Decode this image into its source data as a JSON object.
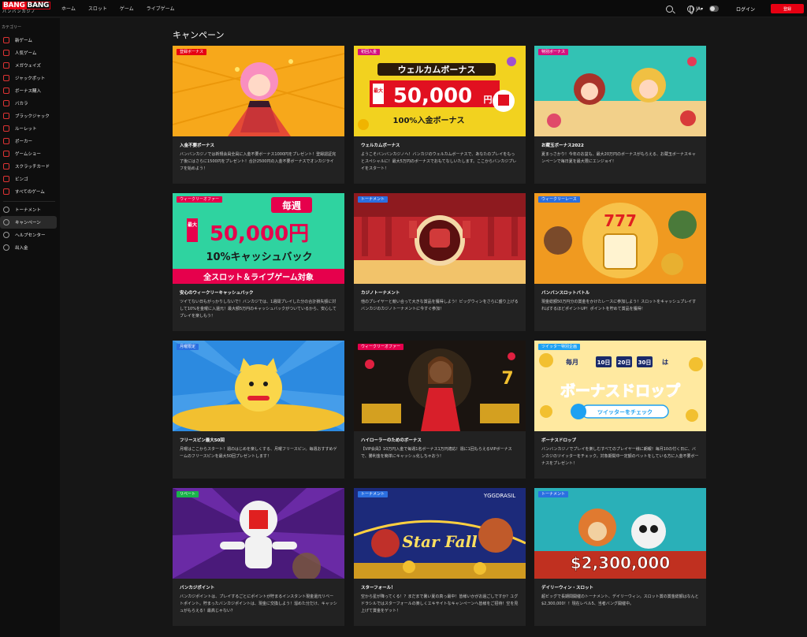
{
  "brand": {
    "logo_a": "BANG",
    "logo_b": "BANG",
    "logo_sub": "バンバンカジノ"
  },
  "nav": [
    "ホーム",
    "スロット",
    "ゲーム",
    "ライブゲーム"
  ],
  "header": {
    "lang": "JA▾",
    "login": "ログイン",
    "register": "登録"
  },
  "sidebar": {
    "category_label": "カテゴリー",
    "items": [
      "新ゲーム",
      "人気ゲーム",
      "メガウェイズ",
      "ジャックポット",
      "ボーナス購入",
      "バカラ",
      "ブラックジャック",
      "ルーレット",
      "ポーカー",
      "ゲームショー",
      "スクラッチカード",
      "ビンゴ",
      "すべてのゲーム"
    ],
    "items2": [
      "トーナメント",
      "キャンペーン",
      "ヘルプセンター",
      "出入金"
    ]
  },
  "page_title": "キャンペーン",
  "colors": {
    "accent": "#e60012",
    "badge_blue": "#2b6fe0"
  },
  "cards": [
    {
      "badge": "登録ボーナス",
      "title": "入金不要ボーナス",
      "desc": "バンバンカジノでは新規会員全員に入金不要ボーナス1000円をプレゼント！登録認証完了後にはさらに1500円をプレゼント！合計2500円の入金不要ボーナスでオンカジライフを始めよう！"
    },
    {
      "badge": "初回入金",
      "title": "ウェルカムボーナス",
      "desc": "ようこそバンバンカジノへ！バンカジのウェルカムボーナスで、あなたのプレイをもっとスペシャルに！最大5万円のボーナスでおもてなしいたします。ここからバンカジプレイをスタート！",
      "img_text1": "ウェルカムボーナス",
      "img_text2": "最大",
      "img_text3": "50,000",
      "img_text4": "円",
      "img_text5": "100%入金ボーナス"
    },
    {
      "badge": "特別ボーナス",
      "title": "お蔵玉ボーナス2022",
      "desc": "夏まっさかり！今年のお盆も、最大20万円のボーナスがもらえる、お蔵玉ボーナスキャンペーンで毎日夏を最大限にエンジョイ！"
    },
    {
      "badge": "ウィークリーオファー",
      "title": "安心のウィークリーキャッシュバック",
      "desc": "ツイてない日もがっかりしないで！バンカジでは、1週間プレイした分の合計損失額に対して10%を金曜に入還元！最大額5万円のキャッシュバックがついているから、安心してプレイを楽しもう！",
      "img_text1": "毎週",
      "img_text2": "最大",
      "img_text3": "50,000円",
      "img_text4": "10%キャッシュバック",
      "img_text5": "全スロット＆ライブゲーム対象"
    },
    {
      "badge": "トーナメント",
      "title": "カジノトーナメント",
      "desc": "他のプレイヤーと競い合って大きな賞品を獲得しよう！ビッグウィンをさらに盛り上げるバンカジのカジノトーナメントに今すぐ参加！"
    },
    {
      "badge": "ウィークリーレース",
      "title": "バンバンスロットバトル",
      "desc": "現金総額50万円分の賞金をかけたレースに参加しよう！スロットをキャッシュプレイすればするほどポイントUP！ポイントを貯めて賞品を獲得！",
      "img_text1": "777"
    },
    {
      "badge": "月曜限定",
      "title": "フリースピン最大50回",
      "desc": "月曜はここからスタート！週のはじめを楽しくする、月曜フリースピン。毎週おすすめゲームのフリースピンを最大50回プレゼントします！"
    },
    {
      "badge": "ウィークリーオファー",
      "title": "ハイローラーのためのボーナス",
      "desc": "【VIP会員】10万円入金で毎週1名ボーナス1万円適応！週に1回もらえるVIPボーナスで、勝利金を簡単にキャッシュ化しちゃおう！"
    },
    {
      "badge": "ツイッター特別企画",
      "title": "ボーナスドロップ",
      "desc": "バンバンカジノでプレイを楽しむすべてのプレイヤー様に朗報！毎月10の付く日に、バンカジのツイッターをチェック。対象期間中一定額のベットをしている方に入金不要ボーナスをプレゼント！",
      "img_text1": "毎月",
      "img_text2": "10日",
      "img_text3": "20日",
      "img_text4": "30日",
      "img_text5": "は",
      "img_text6": "ボーナスドロップ",
      "img_text7": "ツイッターをチェック"
    },
    {
      "badge": "リベート",
      "title": "バンカジポイント",
      "desc": "バンカジポイントは、プレイするごとにポイントが貯まるインスタント現金還元リベートポイント。貯まったバンカジポイントは、現金に交換しよう！溜めた分だけ、キャッシュがもらえる！最高じゃない？"
    },
    {
      "badge": "トーナメント",
      "title": "スターフォール！",
      "desc": "空から星が降ってくる！？まだまで暑い夏の真っ最中！皆様いかがお過ごしですか？ユグドラシルではスターフォールの楽しくエキサイトなキャンペーンへ皆様をご招待！空を見上げて賞金をゲット！",
      "img_text1": "YGGDRASIL",
      "img_text2": "Star Fall"
    },
    {
      "badge": "トーナメント",
      "title": "デイリーウィン・スロット",
      "desc": "超ビッグで長期間開催のトーナメント、デイリーウィン。スロット賞の賞金総額はなんと$2,300,000！！現在レベル5、当者バング開催中。",
      "img_text1": "$2,300,000"
    }
  ]
}
